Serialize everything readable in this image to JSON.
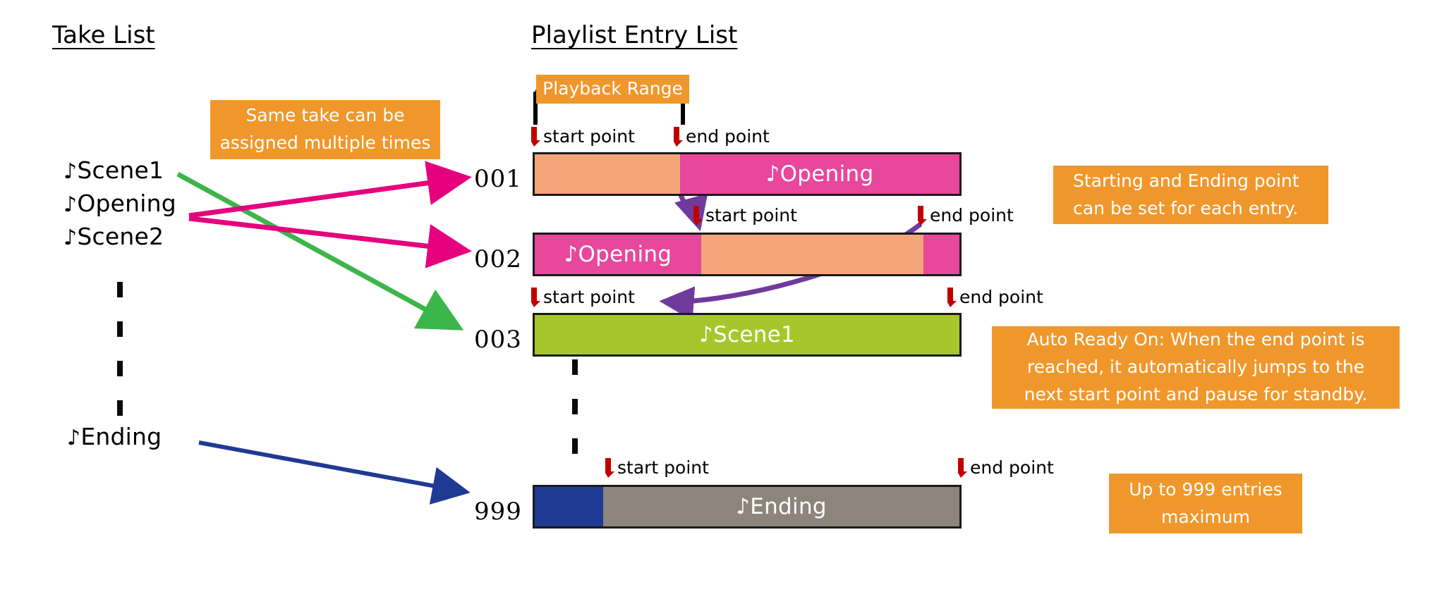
{
  "headings": {
    "take_list": "Take List",
    "playlist": "Playlist Entry List"
  },
  "take_list": {
    "items": [
      {
        "note": "♪",
        "label": "Scene1"
      },
      {
        "note": "♪",
        "label": "Opening"
      },
      {
        "note": "♪",
        "label": "Scene2"
      },
      {
        "note": "♪",
        "label": "Ending"
      }
    ],
    "ellipsis": "vertical-dashed"
  },
  "playback_range_label": "Playback Range",
  "labels": {
    "start_point": "start point",
    "end_point": "end point"
  },
  "entries": [
    {
      "number": "001",
      "segments": [
        {
          "label": "",
          "color": "#f5a57a"
        },
        {
          "label": "♪Opening",
          "color": "#e8479c"
        }
      ],
      "markers": [
        {
          "type": "start",
          "label": "start point"
        },
        {
          "type": "end",
          "label": "end point"
        }
      ]
    },
    {
      "number": "002",
      "segments": [
        {
          "label": "♪Opening",
          "color": "#e8479c"
        },
        {
          "label": "",
          "color": "#f5a57a"
        },
        {
          "label": "",
          "color": "#e8479c"
        }
      ],
      "markers": [
        {
          "type": "start",
          "label": "start point"
        },
        {
          "type": "end",
          "label": "end point"
        }
      ]
    },
    {
      "number": "003",
      "segments": [
        {
          "label": "♪Scene1",
          "color": "#a5c72b"
        }
      ],
      "markers": [
        {
          "type": "start",
          "label": "start point"
        },
        {
          "type": "end",
          "label": "end point"
        }
      ]
    },
    {
      "number": "999",
      "segments": [
        {
          "label": "",
          "color": "#1f3a93"
        },
        {
          "label": "♪Ending",
          "color": "#8d847b"
        }
      ],
      "markers": [
        {
          "type": "start",
          "label": "start point"
        },
        {
          "type": "end",
          "label": "end point"
        }
      ]
    }
  ],
  "callouts": {
    "same_take": [
      "Same take can be",
      "assigned multiple times"
    ],
    "start_end": [
      "Starting and Ending point",
      "can be set for each entry."
    ],
    "auto_ready": [
      "Auto Ready On: When the end point is",
      "reached, it automatically jumps to the",
      "next start point and pause for standby."
    ],
    "max_entries": [
      "Up to 999 entries",
      "maximum"
    ]
  },
  "colors": {
    "callout_orange": "#f0972c",
    "marker_red": "#c00000",
    "arrow_green": "#3cb54a",
    "arrow_magenta": "#e5007e",
    "arrow_blue": "#1f3a93",
    "arrow_purple": "#6f3a9e",
    "bar_peach": "#f5a57a",
    "bar_pink": "#e8479c",
    "bar_green": "#a5c72b",
    "bar_gray": "#8d847b",
    "bar_navy": "#1f3a93"
  }
}
